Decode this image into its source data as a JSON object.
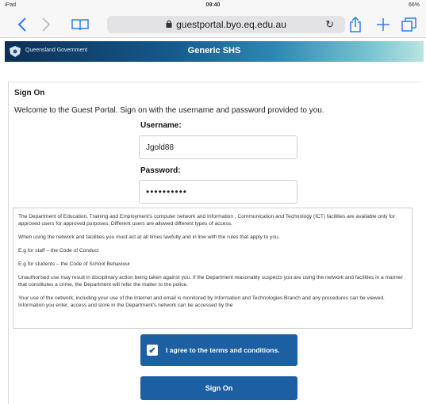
{
  "status_bar": {
    "carrier": "iPad",
    "time": "09:40",
    "battery": "66%"
  },
  "browser": {
    "url": "guestportal.byo.eq.edu.au",
    "icons": {
      "back": "chevron-left-icon",
      "forward": "chevron-right-icon",
      "bookmarks": "book-icon",
      "lock": "lock-icon",
      "reload": "reload-icon",
      "share": "share-icon",
      "new_tab": "plus-icon",
      "tabs": "tabs-icon"
    },
    "accent": "#2f7cf6"
  },
  "header": {
    "gov_label": "Queensland Government",
    "title": "Generic SHS",
    "color": "#165a8c"
  },
  "signon": {
    "section_title": "Sign On",
    "welcome": "Welcome to the Guest Portal. Sign on with the username and password provided to you.",
    "username_label": "Username:",
    "username_value": "Jgold88",
    "password_label": "Password:",
    "password_value": "••••••••••"
  },
  "terms": [
    "The Department of Education, Training and Employment's computer network and Information , Communication and Technology (ICT) facilities are available only for approved users for approved purposes. Different users are allowed different types of access.",
    "When using the network and facilities you must act at all times lawfully and in line with the rules that apply to you.",
    "E.g for staff – the Code of Conduct",
    "E.g for students – the Code of School Behaviour",
    "Unauthorised use may result in disciplinary action being taken against you. If the Department reasonably suspects you are using the network and facilities in a manner that constitutes a crime, the Department will refer the matter to the police.",
    "Your use of the network, including your use of the Internet and email is monitored by Information and Technologies Branch and any procedures can be viewed. Information you enter, access and store in the Department's network can be accessed by the"
  ],
  "agree": {
    "label": "I agree to the terms and conditions.",
    "checked_glyph": "✔"
  },
  "submit": {
    "label": "Sign On"
  },
  "colors": {
    "button": "#1d5fa3"
  }
}
